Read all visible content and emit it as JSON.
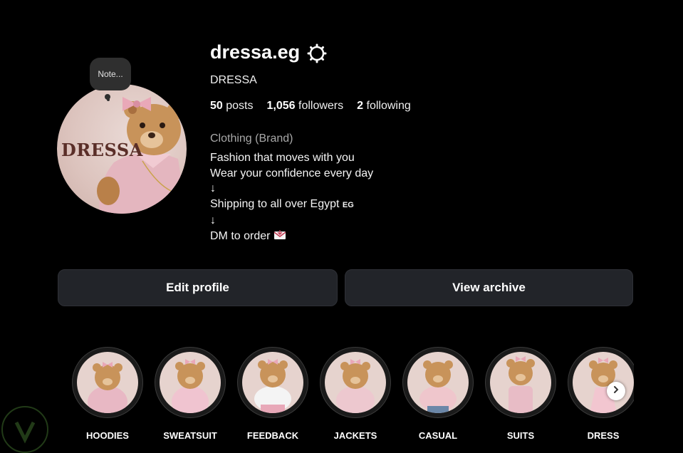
{
  "profile": {
    "username": "dressa.eg",
    "full_name": "DRESSA",
    "avatar_text": "DRESSA",
    "note_label": "Note...",
    "stats": [
      {
        "count": "50",
        "label": "posts"
      },
      {
        "count": "1,056",
        "label": "followers"
      },
      {
        "count": "2",
        "label": "following"
      }
    ],
    "category": "Clothing (Brand)",
    "bio": [
      "Fashion that moves with you",
      "Wear your confidence every day",
      "↓",
      "Shipping to all over Egypt",
      "↓",
      "DM to order"
    ],
    "flag_text": "EG"
  },
  "actions": {
    "edit_profile": "Edit profile",
    "view_archive": "View archive"
  },
  "highlights": [
    {
      "label": "HOODIES",
      "outfit_color": "#e8b8c4"
    },
    {
      "label": "SWEATSUIT",
      "outfit_color": "#f0c4d0"
    },
    {
      "label": "FEEDBACK",
      "outfit_color": "#f4f4f4"
    },
    {
      "label": "JACKETS",
      "outfit_color": "#edc8cf"
    },
    {
      "label": "CASUAL",
      "outfit_color": "#efc6cc"
    },
    {
      "label": "SUITS",
      "outfit_color": "#e8bcc6"
    },
    {
      "label": "DRESS",
      "outfit_color": "#f2c6d0"
    }
  ],
  "colors": {
    "background": "#000000",
    "button_bg": "#222429",
    "bear": "#c8935a",
    "bow": "#e9a8b8"
  }
}
